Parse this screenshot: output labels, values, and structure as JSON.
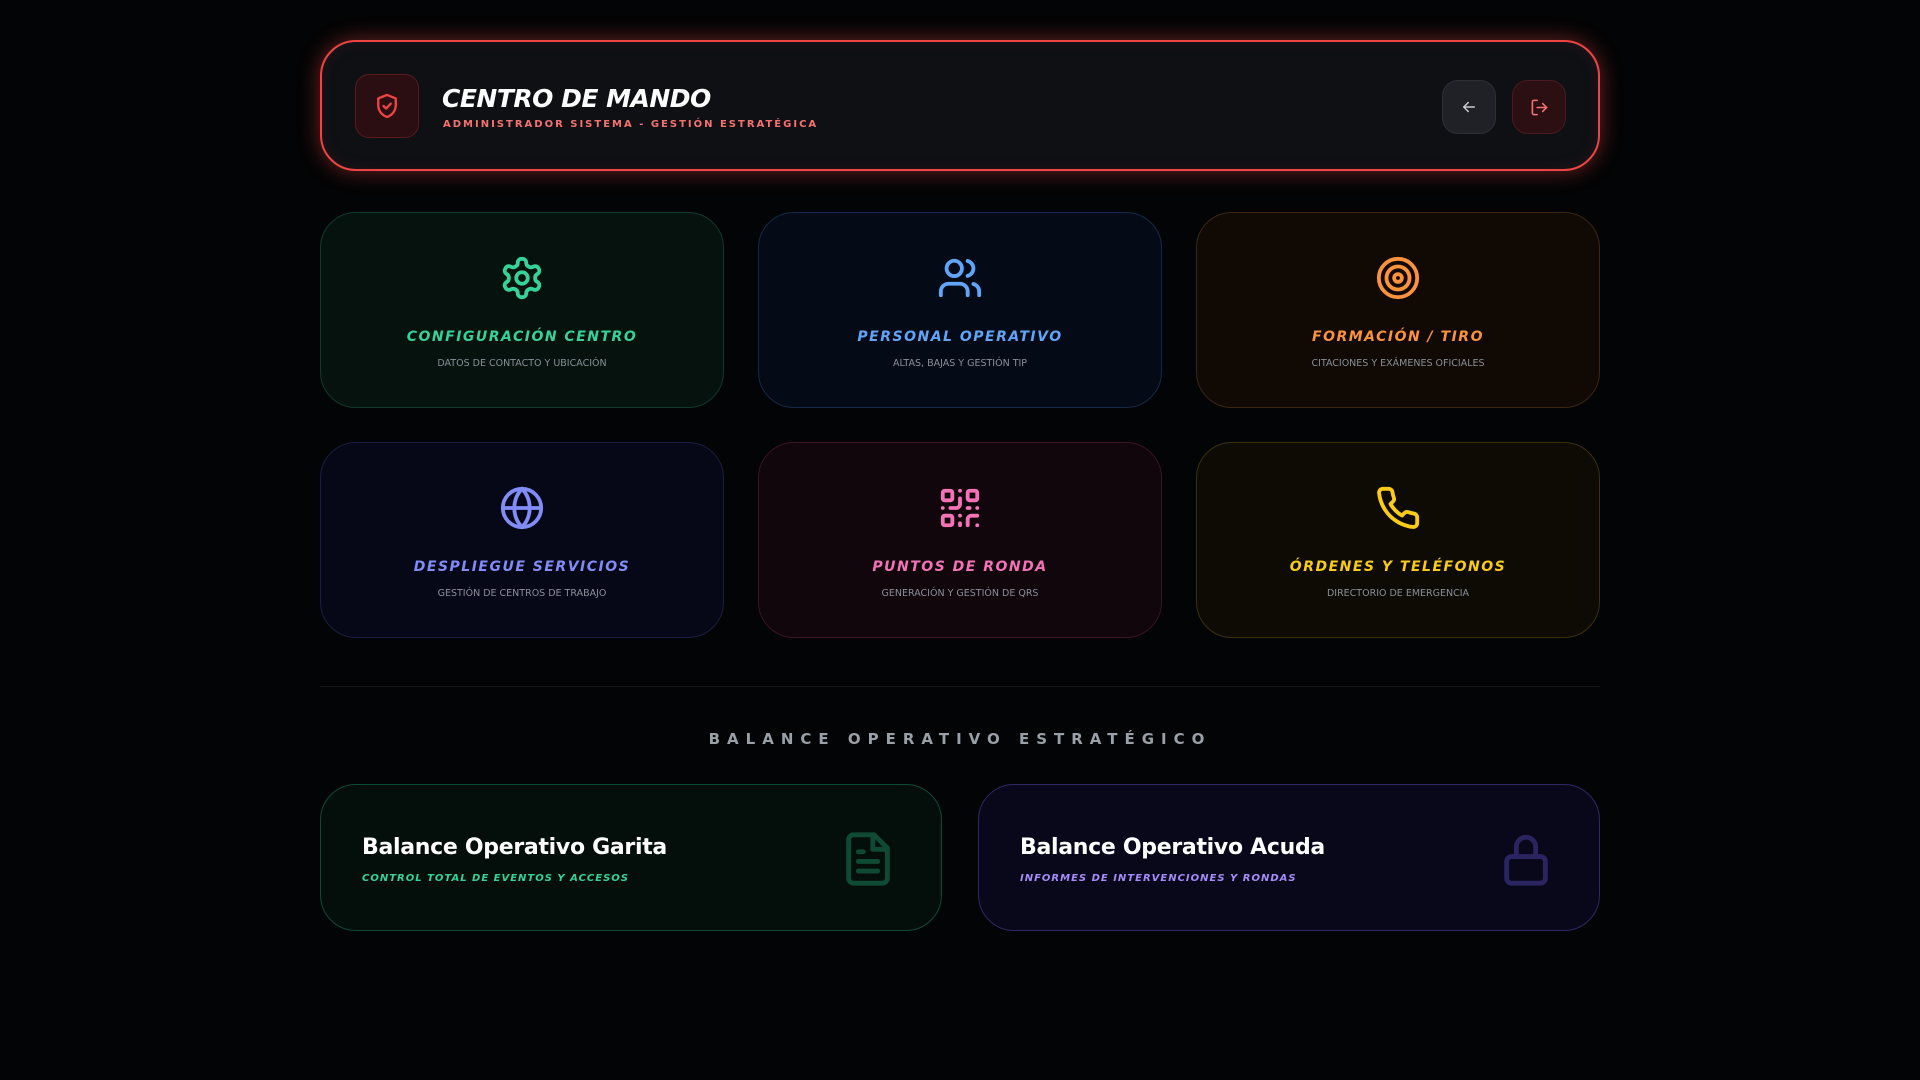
{
  "header": {
    "title": "CENTRO DE MANDO",
    "subtitle": "ADMINISTRADOR SISTEMA - GESTIÓN ESTRATÉGICA"
  },
  "cards": [
    {
      "title": "CONFIGURACIÓN CENTRO",
      "subtitle": "DATOS DE CONTACTO Y UBICACIÓN",
      "color": "#34d399",
      "icon": "gear-icon"
    },
    {
      "title": "PERSONAL OPERATIVO",
      "subtitle": "ALTAS, BAJAS Y GESTIÓN TIP",
      "color": "#60a5fa",
      "icon": "users-icon"
    },
    {
      "title": "FORMACIÓN / TIRO",
      "subtitle": "CITACIONES Y EXÁMENES OFICIALES",
      "color": "#fb923c",
      "icon": "target-icon"
    },
    {
      "title": "DESPLIEGUE SERVICIOS",
      "subtitle": "GESTIÓN DE CENTROS DE TRABAJO",
      "color": "#818cf8",
      "icon": "globe-icon"
    },
    {
      "title": "PUNTOS DE RONDA",
      "subtitle": "GENERACIÓN Y GESTIÓN DE QRS",
      "color": "#f472b6",
      "icon": "qr-code-icon"
    },
    {
      "title": "ÓRDENES Y TELÉFONOS",
      "subtitle": "DIRECTORIO DE EMERGENCIA",
      "color": "#facc15",
      "icon": "phone-icon"
    }
  ],
  "section": {
    "title": "BALANCE OPERATIVO ESTRATÉGICO"
  },
  "balances": [
    {
      "title": "Balance Operativo Garita",
      "subtitle": "CONTROL TOTAL DE EVENTOS Y ACCESOS",
      "color": "#34d399",
      "icon": "document-icon"
    },
    {
      "title": "Balance Operativo Acuda",
      "subtitle": "INFORMES DE INTERVENCIONES Y RONDAS",
      "color": "#a78bfa",
      "icon": "lock-icon"
    }
  ],
  "colors": {
    "accent_red": "#ef4444",
    "background": "#030405"
  }
}
